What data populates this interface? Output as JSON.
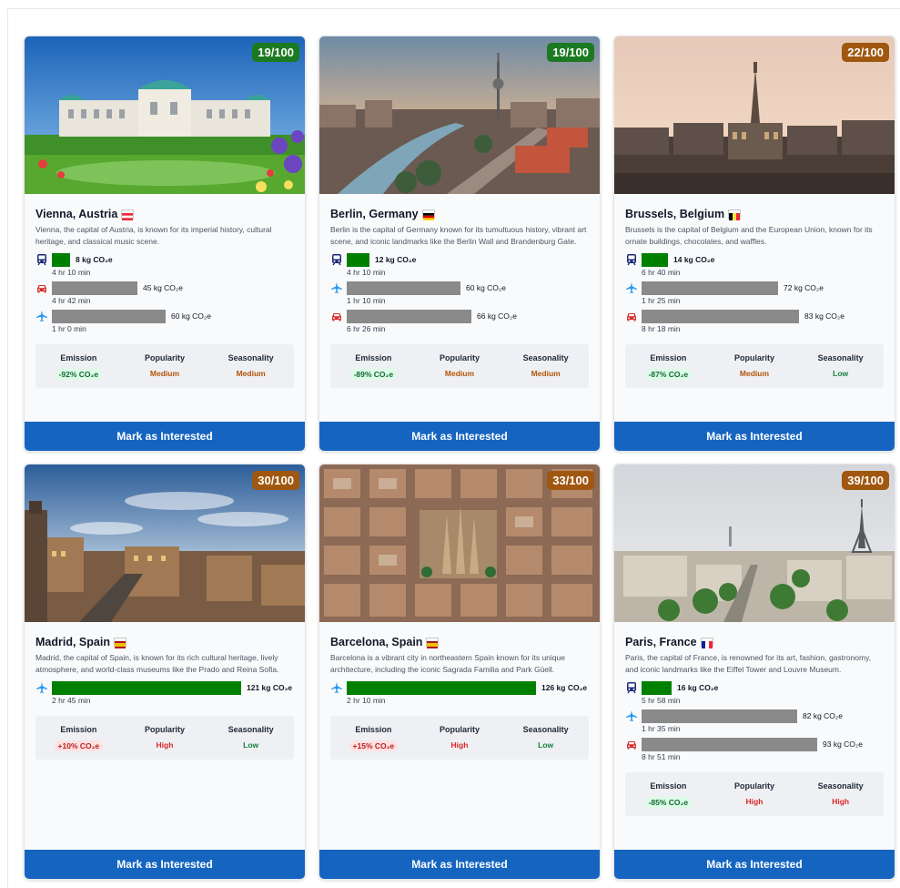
{
  "button_label": "Mark as Interested",
  "stat_headers": {
    "emission": "Emission",
    "popularity": "Popularity",
    "seasonality": "Seasonality"
  },
  "colors": {
    "score_green": "#1b7a21",
    "score_amber": "#a0570f",
    "button": "#1565c0",
    "bar_best": "#008000",
    "bar_other": "#8a8a8a",
    "train_icon": "#1e2a78",
    "plane_icon": "#2196f3",
    "car_icon": "#d32f2f"
  },
  "cards": [
    {
      "score": "19/100",
      "score_color": "green",
      "city": "Vienna, Austria",
      "flag": "austria",
      "description": "Vienna, the capital of Austria, is known for its imperial history, cultural heritage, and classical music scene.",
      "trips": [
        {
          "mode": "train-icon",
          "co2": "8 kg CO₂e",
          "duration": "4 hr 10 min",
          "best": true,
          "level": 0.08
        },
        {
          "mode": "car-icon",
          "co2": "45 kg CO₂e",
          "duration": "4 hr 42 min",
          "best": false,
          "level": 0.45
        },
        {
          "mode": "plane-icon",
          "co2": "60 kg CO₂e",
          "duration": "1 hr 0 min",
          "best": false,
          "level": 0.6
        }
      ],
      "stats": {
        "emission": "-92% CO₂e",
        "emission_tone": "good",
        "popularity": "Medium",
        "seasonality": "Medium"
      }
    },
    {
      "score": "19/100",
      "score_color": "green",
      "city": "Berlin, Germany",
      "flag": "germany",
      "description": "Berlin is the capital of Germany known for its tumultuous history, vibrant art scene, and iconic landmarks like the Berlin Wall and Brandenburg Gate.",
      "trips": [
        {
          "mode": "train-icon",
          "co2": "12 kg CO₂e",
          "duration": "4 hr 10 min",
          "best": true,
          "level": 0.12
        },
        {
          "mode": "plane-icon",
          "co2": "60 kg CO₂e",
          "duration": "1 hr 10 min",
          "best": false,
          "level": 0.6
        },
        {
          "mode": "car-icon",
          "co2": "66 kg CO₂e",
          "duration": "6 hr 26 min",
          "best": false,
          "level": 0.66
        }
      ],
      "stats": {
        "emission": "-89% CO₂e",
        "emission_tone": "good",
        "popularity": "Medium",
        "seasonality": "Medium"
      }
    },
    {
      "score": "22/100",
      "score_color": "amber",
      "city": "Brussels, Belgium",
      "flag": "belgium",
      "description": "Brussels is the capital of Belgium and the European Union, known for its ornate buildings, chocolates, and waffles.",
      "trips": [
        {
          "mode": "train-icon",
          "co2": "14 kg CO₂e",
          "duration": "6 hr 40 min",
          "best": true,
          "level": 0.14
        },
        {
          "mode": "plane-icon",
          "co2": "72 kg CO₂e",
          "duration": "1 hr 25 min",
          "best": false,
          "level": 0.72
        },
        {
          "mode": "car-icon",
          "co2": "83 kg CO₂e",
          "duration": "8 hr 18 min",
          "best": false,
          "level": 0.83
        }
      ],
      "stats": {
        "emission": "-87% CO₂e",
        "emission_tone": "good",
        "popularity": "Medium",
        "seasonality": "Low"
      }
    },
    {
      "score": "30/100",
      "score_color": "amber",
      "city": "Madrid, Spain",
      "flag": "spain",
      "description": "Madrid, the capital of Spain, is known for its rich cultural heritage, lively atmosphere, and world-class museums like the Prado and Reina Sofia.",
      "trips": [
        {
          "mode": "plane-icon",
          "co2": "121 kg CO₂e",
          "duration": "2 hr 45 min",
          "best": true,
          "level": 1.0
        }
      ],
      "stats": {
        "emission": "+10% CO₂e",
        "emission_tone": "bad",
        "popularity": "High",
        "seasonality": "Low"
      }
    },
    {
      "score": "33/100",
      "score_color": "amber",
      "city": "Barcelona, Spain",
      "flag": "spain",
      "description": "Barcelona is a vibrant city in northeastern Spain known for its unique architecture, including the iconic Sagrada Familia and Park Güell.",
      "trips": [
        {
          "mode": "plane-icon",
          "co2": "126 kg CO₂e",
          "duration": "2 hr 10 min",
          "best": true,
          "level": 1.0
        }
      ],
      "stats": {
        "emission": "+15% CO₂e",
        "emission_tone": "bad",
        "popularity": "High",
        "seasonality": "Low"
      }
    },
    {
      "score": "39/100",
      "score_color": "amber",
      "city": "Paris, France",
      "flag": "france",
      "description": "Paris, the capital of France, is renowned for its art, fashion, gastronomy, and iconic landmarks like the Eiffel Tower and Louvre Museum.",
      "trips": [
        {
          "mode": "train-icon",
          "co2": "16 kg CO₂e",
          "duration": "5 hr 58 min",
          "best": true,
          "level": 0.16
        },
        {
          "mode": "plane-icon",
          "co2": "82 kg CO₂e",
          "duration": "1 hr 35 min",
          "best": false,
          "level": 0.82
        },
        {
          "mode": "car-icon",
          "co2": "93 kg CO₂e",
          "duration": "8 hr 51 min",
          "best": false,
          "level": 0.93
        }
      ],
      "stats": {
        "emission": "-85% CO₂e",
        "emission_tone": "good",
        "popularity": "High",
        "seasonality": "High"
      }
    }
  ]
}
